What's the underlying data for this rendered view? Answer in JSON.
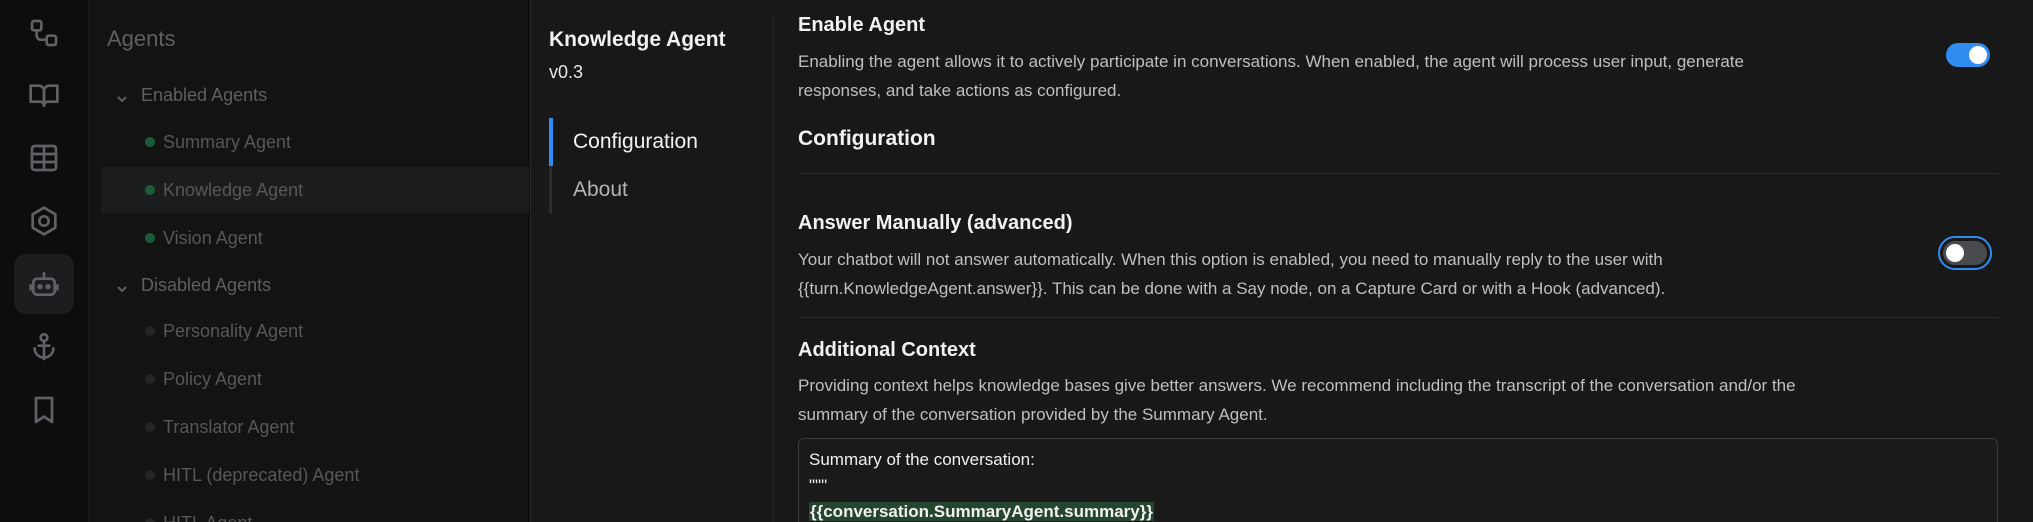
{
  "rail": {
    "icons": [
      "flow-icon",
      "book-icon",
      "table-icon",
      "hexagon-icon",
      "bot-icon",
      "anchor-icon",
      "bookmark-icon"
    ],
    "active": "bot-icon"
  },
  "background_panel": {
    "title": "Agents",
    "groups": [
      {
        "label": "Enabled Agents",
        "items": [
          "Summary Agent",
          "Knowledge Agent",
          "Vision Agent"
        ]
      },
      {
        "label": "Disabled Agents",
        "items": [
          "Personality Agent",
          "Policy Agent",
          "Translator Agent",
          "HITL (deprecated) Agent",
          "HITL Agent"
        ]
      }
    ],
    "selected": "Knowledge Agent"
  },
  "modal": {
    "agent_name": "Knowledge Agent",
    "version": "v0.3",
    "nav": [
      "Configuration",
      "About"
    ],
    "enable": {
      "title": "Enable Agent",
      "description": "Enabling the agent allows it to actively participate in conversations. When enabled, the agent will process user input, generate responses, and take actions as configured.",
      "enabled": true
    },
    "configuration_heading": "Configuration",
    "answer_manually": {
      "title": "Answer Manually (advanced)",
      "description": "Your chatbot will not answer automatically. When this option is enabled, you need to manually reply to the user with {{turn.KnowledgeAgent.answer}}. This can be done with a Say node, on a Capture Card or with a Hook (advanced).",
      "enabled": false
    },
    "additional_context": {
      "title": "Additional Context",
      "description": "Providing context helps knowledge bases give better answers. We recommend including the transcript of the conversation and/or the summary of the conversation provided by the Summary Agent.",
      "lines": [
        "Summary of the conversation:",
        "\"\"\"",
        "{{conversation.SummaryAgent.summary}}"
      ]
    }
  },
  "colors": {
    "accent": "#2f8cf0",
    "enabled_dot": "#1c5c3a",
    "highlight_bg": "#24452e"
  }
}
